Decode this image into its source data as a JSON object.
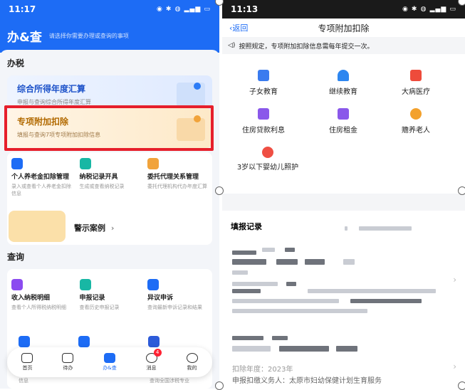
{
  "left": {
    "status_time": "11:17",
    "header_title": "办&查",
    "header_sub": "请选择你需要办理或查询的事项",
    "tax_section": "办税",
    "annual": {
      "title": "综合所得年度汇算",
      "desc": "申报与查询综合所得年度汇算"
    },
    "special": {
      "title": "专项附加扣除",
      "desc": "填报与查询7项专项附加扣除信息"
    },
    "grid1": [
      {
        "title": "个人养老金扣除管理",
        "desc": "录入或查看个人养老金扣除信息"
      },
      {
        "title": "纳税记录开具",
        "desc": "生成或查看纳税记录"
      },
      {
        "title": "委托代理关系管理",
        "desc": "委托代理机构代办年度汇算"
      }
    ],
    "warning": "警示案例",
    "query_section": "查询",
    "grid2": [
      {
        "title": "收入纳税明细",
        "desc": "查看个人所得税纳税明细"
      },
      {
        "title": "申报记录",
        "desc": "查看历史申报记录"
      },
      {
        "title": "异议申诉",
        "desc": "查询最新申诉记录和结果"
      }
    ],
    "grid3_desc": [
      "信息",
      "",
      "查询全国涉税专业"
    ],
    "tabs": [
      {
        "label": "首页"
      },
      {
        "label": "待办"
      },
      {
        "label": "办&查"
      },
      {
        "label": "消息",
        "badge": "4"
      },
      {
        "label": "我的"
      }
    ]
  },
  "right": {
    "status_time": "11:13",
    "back": "返回",
    "title": "专项附加扣除",
    "notice": "按照规定，专项附加扣除信息需每年提交一次。",
    "items": [
      "子女教育",
      "继续教育",
      "大病医疗",
      "住房贷款利息",
      "住房租金",
      "赡养老人",
      "3岁以下婴幼儿照护"
    ],
    "records_title": "填报记录",
    "footer1": "扣除年度：2023年",
    "footer2": "申报扣缴义务人：太原市妇幼保健计划生育服务"
  }
}
